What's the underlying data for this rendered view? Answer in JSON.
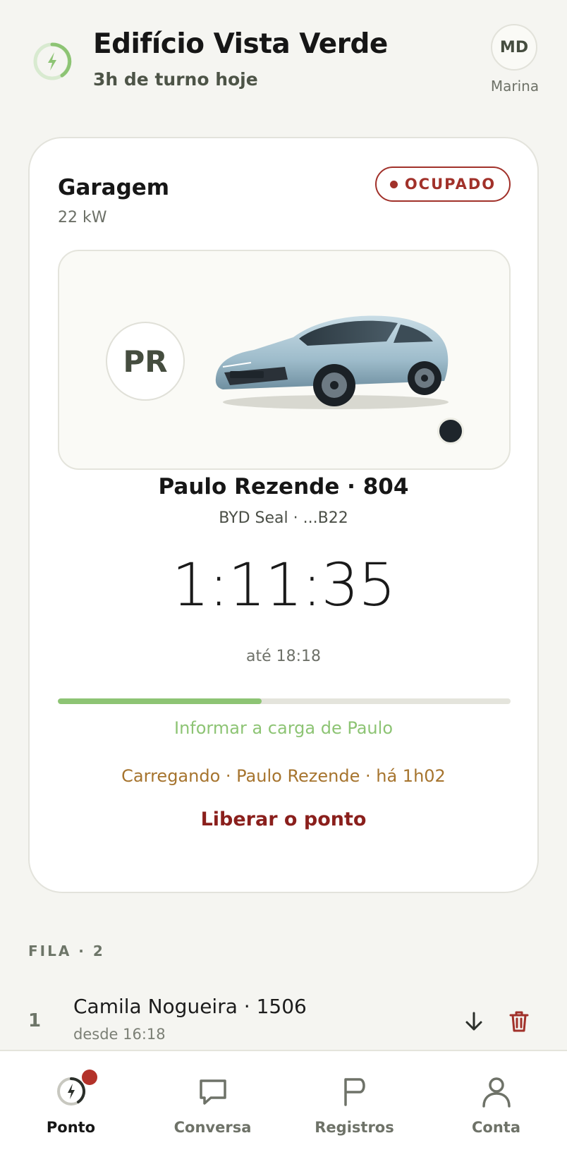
{
  "header": {
    "title": "Edifício Vista Verde",
    "subtitle": "3h de turno hoje",
    "user_initials": "MD",
    "user_name": "Marina"
  },
  "charger": {
    "name": "Garagem",
    "power": "22 kW",
    "status": "OCUPADO",
    "status_color": "#a1312a",
    "driver_initials": "PR",
    "driver_line": "Paulo Rezende · 804",
    "vehicle_line": "BYD Seal · ...B22",
    "vehicle_color": "#1e252b",
    "elapsed": "1:11:35",
    "until": "até 18:18",
    "progress_fraction": 0.45,
    "inform_link": "Informar a carga de Paulo",
    "activity": "Carregando · Paulo Rezende · há 1h02",
    "release_link": "Liberar o ponto"
  },
  "queue": {
    "heading": "FILA · 2",
    "items": [
      {
        "position": "1",
        "name": "Camila Nogueira · 1506",
        "since": "desde 16:18"
      }
    ]
  },
  "nav": {
    "items": [
      {
        "label": "Ponto",
        "icon": "charger-icon",
        "active": true,
        "badge": true
      },
      {
        "label": "Conversa",
        "icon": "chat-icon"
      },
      {
        "label": "Registros",
        "icon": "flag-icon"
      },
      {
        "label": "Conta",
        "icon": "person-icon"
      }
    ]
  },
  "colors": {
    "accent_green": "#8dc474",
    "danger": "#8a1f1c",
    "warning_text": "#a6742e",
    "background": "#f5f5f1"
  }
}
